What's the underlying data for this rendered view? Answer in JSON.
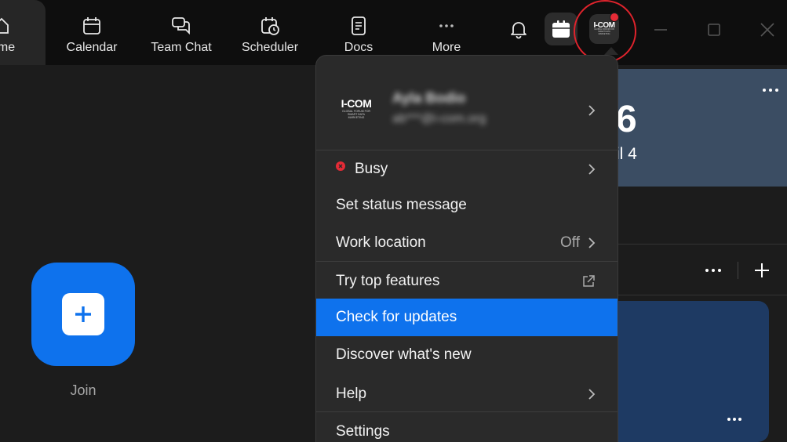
{
  "nav": {
    "home": "ome",
    "calendar": "Calendar",
    "team_chat": "Team Chat",
    "scheduler": "Scheduler",
    "docs": "Docs",
    "more": "More"
  },
  "logo": {
    "title": "I-COM",
    "subtitle": "GLOBAL FORUM FOR SMART DATA MARKETING"
  },
  "profile": {
    "name": "Ayla Bodio",
    "email": "ab***@i-com.org"
  },
  "menu": {
    "status": "Busy",
    "set_status": "Set status message",
    "work_location": "Work location",
    "work_location_value": "Off",
    "try_features": "Try top features",
    "check_updates": "Check for updates",
    "discover": "Discover what's new",
    "help": "Help",
    "settings": "Settings"
  },
  "join": {
    "label": "Join"
  },
  "date_card": {
    "number": "6",
    "text": "il 4"
  },
  "colors": {
    "accent": "#0e72ed",
    "busy": "#e52b36",
    "highlight_ring": "#e0232c"
  }
}
